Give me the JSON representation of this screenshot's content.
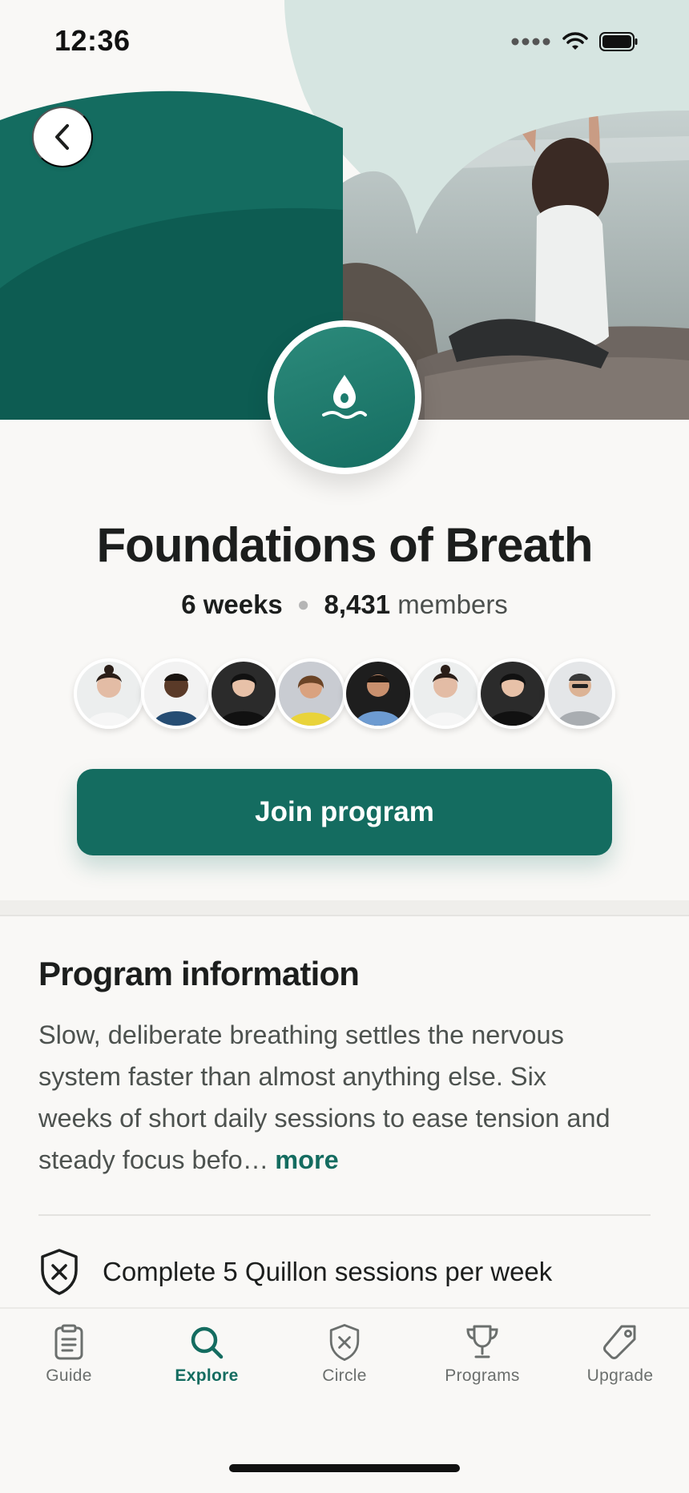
{
  "status_bar": {
    "time": "12:36"
  },
  "program": {
    "title": "Foundations of Breath",
    "duration": "6 weeks",
    "member_count": "8,431",
    "members_label": "members",
    "join_label": "Join program"
  },
  "members_preview": [
    {
      "id": "member-1"
    },
    {
      "id": "member-2"
    },
    {
      "id": "member-3"
    },
    {
      "id": "member-4"
    },
    {
      "id": "member-5"
    },
    {
      "id": "member-6"
    },
    {
      "id": "member-7"
    },
    {
      "id": "member-8"
    }
  ],
  "info": {
    "title": "Program information",
    "description": "Slow, deliberate breathing settles the nervous system faster than almost anything else. Six weeks of short daily sessions to ease tension and steady focus befo…",
    "more_label": "more",
    "requirement": "Complete 5 Quillon sessions per week"
  },
  "tabs": [
    {
      "label": "Guide",
      "icon": "clipboard-icon"
    },
    {
      "label": "Explore",
      "icon": "search-icon",
      "active": true
    },
    {
      "label": "Circle",
      "icon": "shield-x-icon"
    },
    {
      "label": "Programs",
      "icon": "trophy-icon"
    },
    {
      "label": "Upgrade",
      "icon": "tag-icon"
    }
  ],
  "colors": {
    "brand": "#146c60",
    "brand_dark": "#0d5c52",
    "background": "#f9f8f6"
  }
}
